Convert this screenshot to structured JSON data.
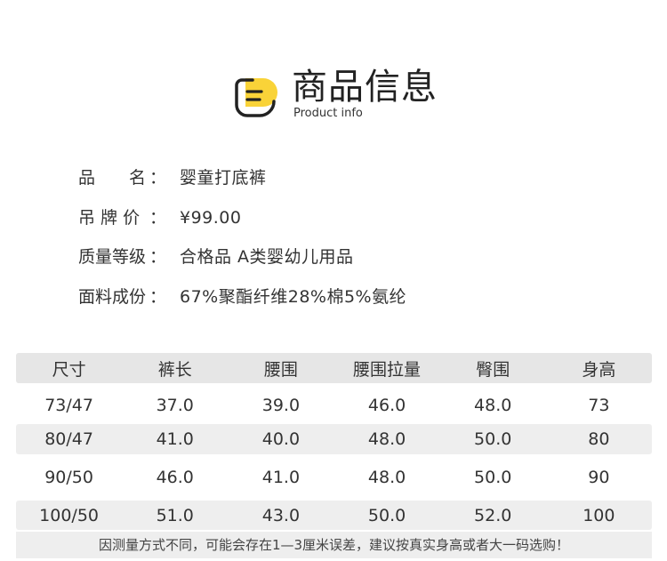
{
  "header": {
    "title": "商品信息",
    "subtitle": "Product info",
    "logo_icon": "document-lines-icon",
    "accent_color": "#f9d338"
  },
  "info": [
    {
      "label": "品　　名",
      "colon": "：",
      "value": "婴童打底裤"
    },
    {
      "label": "吊 牌 价",
      "colon": "：",
      "value": "¥99.00"
    },
    {
      "label": "质量等级",
      "colon": "：",
      "value": "合格品 A类婴幼儿用品"
    },
    {
      "label": "面料成份",
      "colon": "：",
      "value": "67%聚酯纤维28%棉5%氨纶"
    }
  ],
  "table": {
    "headers": [
      "尺寸",
      "裤长",
      "腰围",
      "腰围拉量",
      "臀围",
      "身高"
    ],
    "rows": [
      [
        "73/47",
        "37.0",
        "39.0",
        "46.0",
        "48.0",
        "73"
      ],
      [
        "80/47",
        "41.0",
        "40.0",
        "48.0",
        "50.0",
        "80"
      ],
      [
        "90/50",
        "46.0",
        "41.0",
        "48.0",
        "50.0",
        "90"
      ],
      [
        "100/50",
        "51.0",
        "43.0",
        "50.0",
        "52.0",
        "100"
      ]
    ]
  },
  "note": "因测量方式不同，可能会存在1—3厘米误差，建议按真实身高或者大一码选购！"
}
